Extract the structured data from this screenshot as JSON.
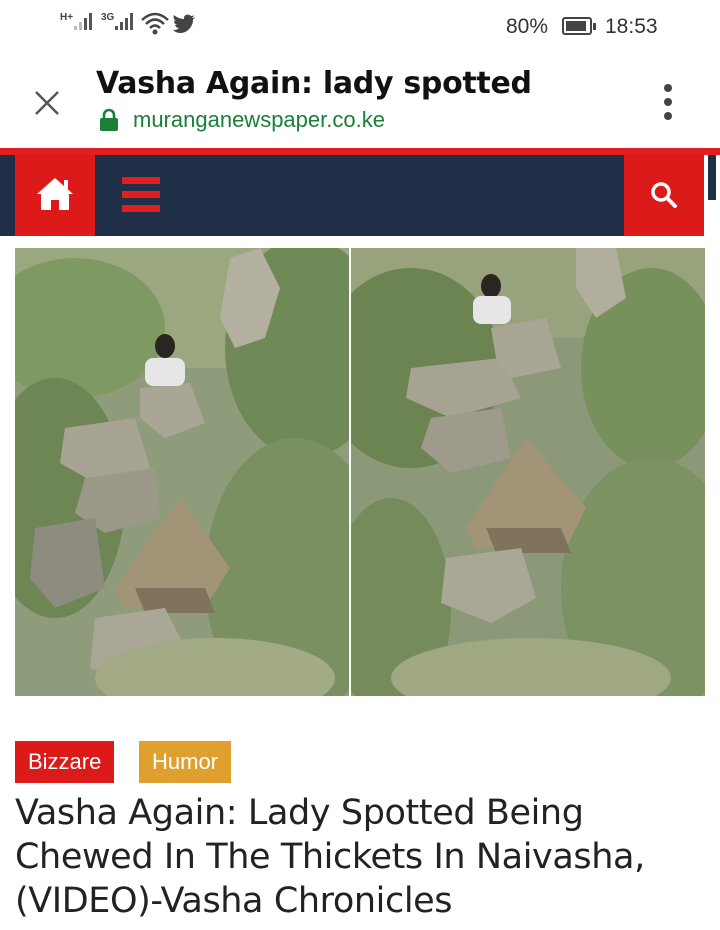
{
  "status_bar": {
    "network_1": "H+",
    "network_2": "3G",
    "battery": "80%",
    "time": "18:53",
    "icons": [
      "signal-icon",
      "wifi-icon",
      "twitter-icon",
      "battery-icon"
    ]
  },
  "browser": {
    "page_title": "Vasha Again: lady spotted",
    "domain": "muranganewspaper.co.ke",
    "secure_color": "#1a7f37",
    "icons": [
      "close-icon",
      "lock-icon",
      "more-vert-icon"
    ]
  },
  "site_nav": {
    "icons": [
      "home-icon",
      "hamburger-menu-icon",
      "search-icon"
    ],
    "accent": "#dd1a1a",
    "bar_color": "#202f48"
  },
  "article": {
    "tags": [
      {
        "label": "Bizzare",
        "color": "#dd1a1a"
      },
      {
        "label": "Humor",
        "color": "#e0a030"
      }
    ],
    "headline": "Vasha Again: Lady Spotted Being Chewed In The Thickets In Naivasha, (VIDEO)-Vasha Chronicles"
  }
}
